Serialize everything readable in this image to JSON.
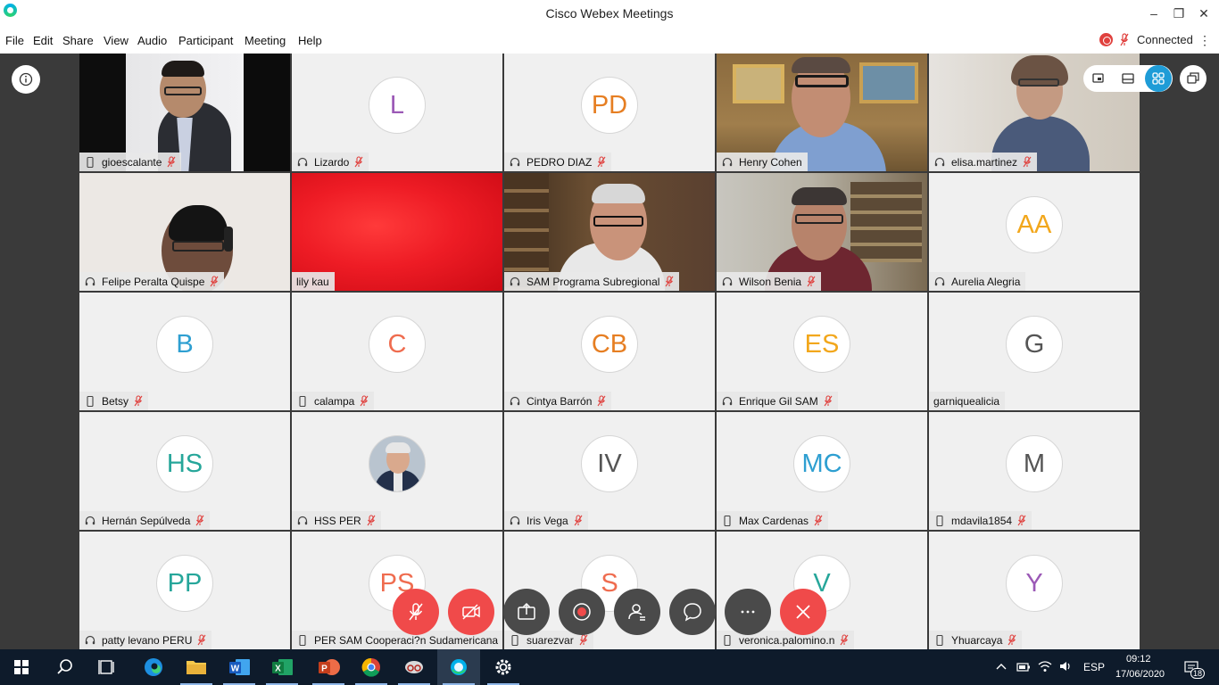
{
  "window": {
    "title": "Cisco Webex Meetings",
    "controls": [
      "minimize",
      "restore",
      "close"
    ]
  },
  "menu": [
    "File",
    "Edit",
    "Share",
    "View",
    "Audio",
    "Participant",
    "Meeting",
    "Help"
  ],
  "connection": {
    "status": "Connected",
    "recording_icon": "record-icon",
    "mic_icon": "mic-muted-icon"
  },
  "colors": {
    "accent": "#1ab3e8",
    "danger": "#f04a4a",
    "meeting_bg": "#3a3a3a",
    "tile_bg": "#f0f0f0"
  },
  "layout_buttons": [
    "floating-panel-icon",
    "filmstrip-icon",
    "grid-view-icon"
  ],
  "participants": [
    {
      "name": "gioescalante",
      "device": "phone",
      "muted": true,
      "video": true
    },
    {
      "name": "Lizardo",
      "initials": "L",
      "color": "#9b59b6",
      "device": "headset",
      "muted": true
    },
    {
      "name": "PEDRO DIAZ",
      "initials": "PD",
      "color": "#e67e22",
      "device": "headset",
      "muted": true
    },
    {
      "name": "Henry Cohen",
      "device": "headset",
      "muted": false,
      "video": true,
      "active": true
    },
    {
      "name": "elisa.martinez",
      "device": "headset",
      "muted": true,
      "video": true
    },
    {
      "name": "Felipe Peralta Quispe",
      "device": "headset",
      "muted": true,
      "video": true
    },
    {
      "name": "lily kau",
      "device": "none",
      "muted": false,
      "video": true
    },
    {
      "name": "SAM Programa Subregional",
      "device": "headset",
      "muted": true,
      "video": true
    },
    {
      "name": "Wilson Benia",
      "device": "headset",
      "muted": true,
      "video": true
    },
    {
      "name": "Aurelia Alegria",
      "initials": "AA",
      "color": "#f2a71c",
      "device": "headset",
      "muted": false
    },
    {
      "name": "Betsy",
      "initials": "B",
      "color": "#2e9fd1",
      "device": "phone",
      "muted": true
    },
    {
      "name": "calampa",
      "initials": "C",
      "color": "#ef6c4f",
      "device": "phone",
      "muted": true
    },
    {
      "name": "Cintya Barrón",
      "initials": "CB",
      "color": "#e67e22",
      "device": "headset",
      "muted": true
    },
    {
      "name": "Enrique Gil SAM",
      "initials": "ES",
      "color": "#f2a71c",
      "device": "headset",
      "muted": true
    },
    {
      "name": "garniquealicia",
      "initials": "G",
      "color": "#555555",
      "device": "none",
      "muted": false
    },
    {
      "name": "Hernán Sepúlveda",
      "initials": "HS",
      "color": "#26a69a",
      "device": "headset",
      "muted": true
    },
    {
      "name": "HSS PER",
      "device": "headset",
      "muted": true,
      "photo": true
    },
    {
      "name": "Iris Vega",
      "initials": "IV",
      "color": "#555555",
      "device": "headset",
      "muted": true
    },
    {
      "name": "Max Cardenas",
      "initials": "MC",
      "color": "#2e9fd1",
      "device": "phone",
      "muted": true
    },
    {
      "name": "mdavila1854",
      "initials": "M",
      "color": "#555555",
      "device": "phone",
      "muted": true
    },
    {
      "name": "patty levano PERU",
      "initials": "PP",
      "color": "#26a69a",
      "device": "headset",
      "muted": true
    },
    {
      "name": "PER SAM Cooperaci?n Sudamericana",
      "initials": "PS",
      "color": "#ef6c4f",
      "device": "phone",
      "muted": false
    },
    {
      "name": "suarezvar",
      "initials": "S",
      "color": "#ef6c4f",
      "device": "phone",
      "muted": true
    },
    {
      "name": "veronica.palomino.n",
      "initials": "V",
      "color": "#26a69a",
      "device": "phone",
      "muted": true
    },
    {
      "name": "Yhuarcaya",
      "initials": "Y",
      "color": "#9b59b6",
      "device": "phone",
      "muted": true
    }
  ],
  "controls": [
    {
      "name": "mute",
      "icon": "mic-muted-icon",
      "color": "red"
    },
    {
      "name": "stop-video",
      "icon": "video-off-icon",
      "color": "red"
    },
    {
      "name": "share",
      "icon": "share-icon",
      "color": "dark"
    },
    {
      "name": "record",
      "icon": "record-icon",
      "color": "dark"
    },
    {
      "name": "participants",
      "icon": "participants-icon",
      "color": "dark"
    },
    {
      "name": "chat",
      "icon": "chat-icon",
      "color": "dark"
    },
    {
      "name": "more",
      "icon": "more-icon",
      "color": "dark"
    },
    {
      "name": "leave",
      "icon": "close-icon",
      "color": "red"
    }
  ],
  "taskbar": {
    "apps": [
      "windows-start-icon",
      "search-icon",
      "task-view-icon",
      "edge-icon",
      "file-explorer-icon",
      "word-icon",
      "excel-icon",
      "powerpoint-icon",
      "chrome-icon",
      "snipping-icon",
      "webex-icon",
      "settings-icon"
    ],
    "language": "ESP",
    "time": "09:12",
    "date": "17/06/2020",
    "notifications": "18"
  }
}
